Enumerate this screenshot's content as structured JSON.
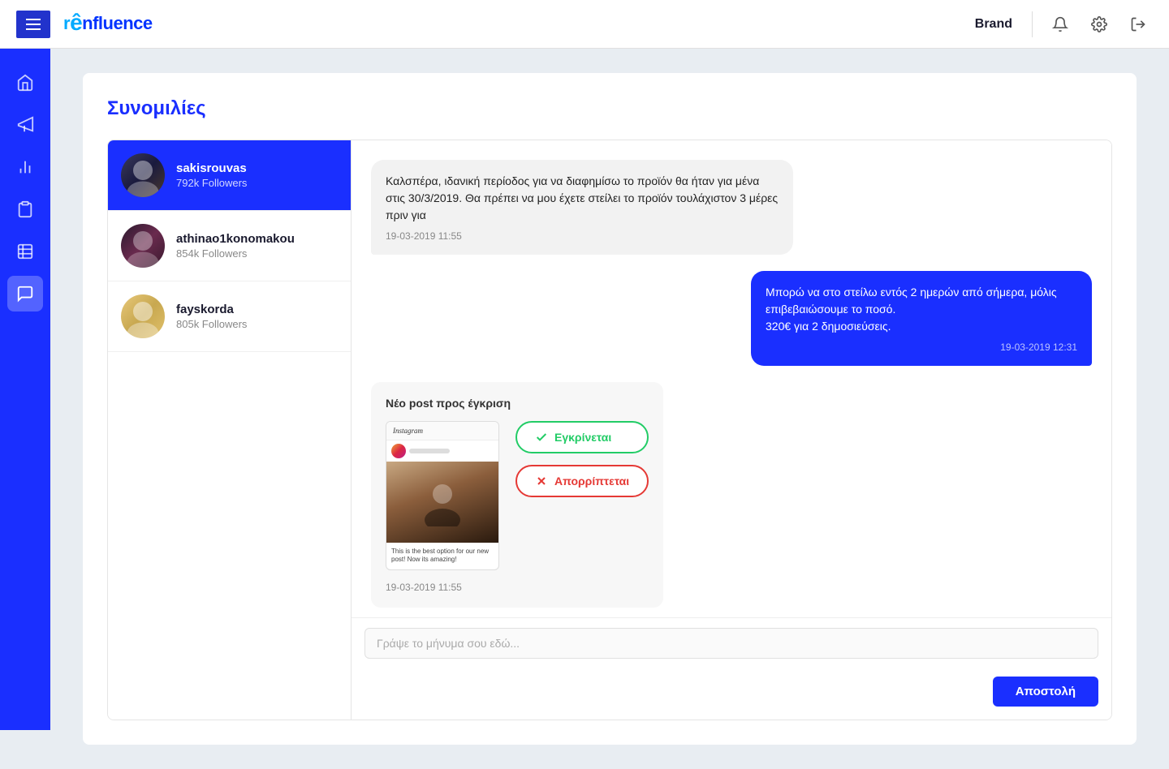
{
  "header": {
    "brand_label": "Brand",
    "logo_text": "r",
    "logo_text2": "nfluence",
    "menu_icon": "☰"
  },
  "topnav_icons": {
    "bell": "🔔",
    "settings": "⚙",
    "logout": "⬚"
  },
  "sidebar": {
    "items": [
      {
        "name": "home",
        "icon": "⌂",
        "label": "Home"
      },
      {
        "name": "campaigns",
        "icon": "📣",
        "label": "Campaigns"
      },
      {
        "name": "analytics",
        "icon": "📊",
        "label": "Analytics"
      },
      {
        "name": "tasks",
        "icon": "📋",
        "label": "Tasks"
      },
      {
        "name": "reports",
        "icon": "📰",
        "label": "Reports"
      },
      {
        "name": "messages",
        "icon": "💬",
        "label": "Messages",
        "active": true
      }
    ]
  },
  "page_title": "Συνομιλίες",
  "contacts": [
    {
      "id": "sakisrouvas",
      "name": "sakisrouvas",
      "followers": "792k Followers",
      "active": true
    },
    {
      "id": "athinao1konomakou",
      "name": "athinao1konomakou",
      "followers": "854k Followers",
      "active": false
    },
    {
      "id": "fayskorda",
      "name": "fayskorda",
      "followers": "805k Followers",
      "active": false
    }
  ],
  "messages": [
    {
      "type": "left",
      "text": "Καλσπέρα, ιδανική περίοδος για να διαφημίσω το προϊόν θα ήταν για μένα στις 30/3/2019. Θα πρέπει να μου έχετε στείλει το προϊόν τουλάχιστον 3 μέρες πριν για",
      "time": "19-03-2019 11:55"
    },
    {
      "type": "right",
      "text": "Μπορώ να στο στείλω εντός 2 ημερών από σήμερα, μόλις επιβεβαιώσουμε το ποσό.\n320€ για 2 δημοσιεύσεις.",
      "time": "19-03-2019 12:31"
    },
    {
      "type": "post-approval",
      "title": "Νέο post προς έγκριση",
      "approve_label": "Εγκρίνεται",
      "reject_label": "Απορρίπτεται",
      "time": "19-03-2019 11:55",
      "ig_caption": "This is the best option for our new post! Now its amazing!"
    }
  ],
  "chat_input": {
    "placeholder": "Γράψε το μήνυμα σου εδώ...",
    "send_button": "Αποστολή"
  }
}
